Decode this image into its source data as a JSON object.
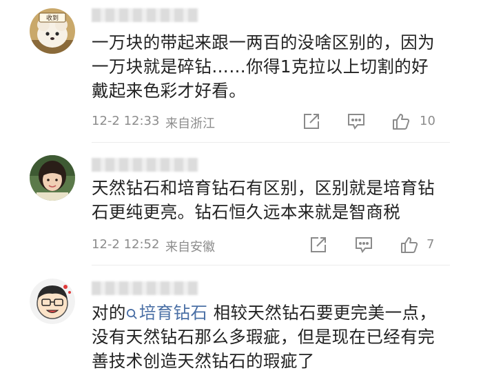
{
  "comments": [
    {
      "avatar_badge": "收到",
      "text": "一万块的带起来跟一两百的没啥区别的，因为一万块就是碎钻……你得1克拉以上切割的好戴起来色彩才好看。",
      "time": "12-2 12:33",
      "location": "来自浙江",
      "likes": "10"
    },
    {
      "text": "天然钻石和培育钻石有区别，区别就是培育钻石更纯更亮。钻石恒久远本来就是智商税",
      "time": "12-2 12:52",
      "location": "来自安徽",
      "likes": "7"
    },
    {
      "text_prefix": "对的",
      "topic_link": "培育钻石",
      "text_suffix": " 相较天然钻石要更完美一点，没有天然钻石那么多瑕疵，但是现在已经有完善技术创造天然钻石的瑕疵了"
    }
  ],
  "icons": {
    "share": "share-icon",
    "comment": "comment-icon",
    "like": "thumbs-up-icon",
    "search": "search-icon"
  },
  "colors": {
    "text": "#222222",
    "meta": "#8c8c8c",
    "link": "#4a6fa5",
    "icon": "#8a8a8a"
  }
}
